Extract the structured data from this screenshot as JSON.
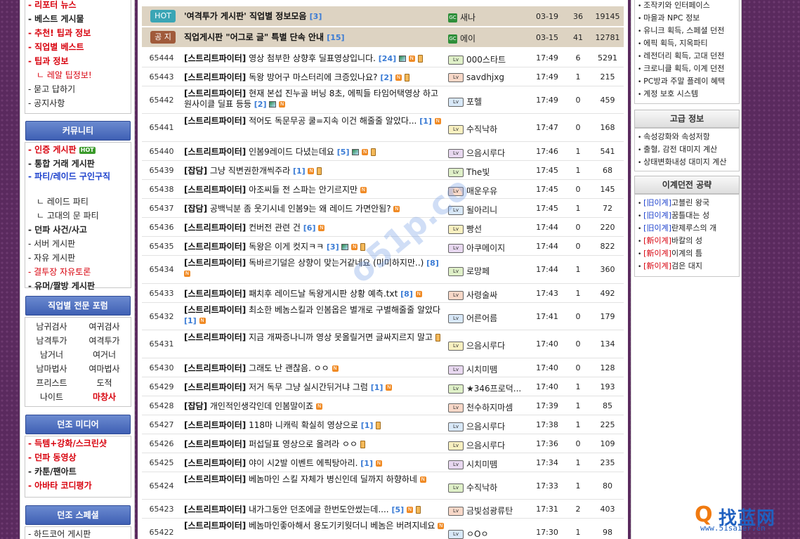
{
  "left_nav": {
    "top_items": [
      {
        "label": "리포터 뉴스",
        "style": "bold-red"
      },
      {
        "label": "베스트 게시물",
        "style": "bold"
      },
      {
        "label": "추천! 팁과 정보",
        "style": "bold-red"
      },
      {
        "label": "직업별 베스트",
        "style": "bold-red"
      },
      {
        "label": "팁과 정보",
        "style": "bold-red"
      },
      {
        "label": "ㄴ 레알 팁정보!",
        "style": "sub-red"
      },
      {
        "label": "묻고 답하기",
        "style": "normal"
      },
      {
        "label": "공지사항",
        "style": "normal"
      }
    ],
    "community_title": "커뮤니티",
    "community_items": [
      {
        "label": "인증 게시판",
        "style": "bold-red",
        "badge": "HOT"
      },
      {
        "label": "통합 거래 게시판",
        "style": "bold"
      },
      {
        "label": "파티/레이드 구인구직",
        "style": "bold-blue"
      },
      {
        "label": "ㄴ 레이드 파티",
        "style": "sub"
      },
      {
        "label": "ㄴ 고대의 문 파티",
        "style": "sub"
      },
      {
        "label": "던파 사건/사고",
        "style": "bold"
      },
      {
        "label": "서버 게시판",
        "style": "normal"
      },
      {
        "label": "자유 게시판",
        "style": "normal"
      },
      {
        "label": "결투장 자유토론",
        "style": "red"
      },
      {
        "label": "유머/짤방 게시판",
        "style": "bold"
      }
    ],
    "forum_title": "직업별 전문 포럼",
    "forum_items": [
      "남귀검사",
      "여귀검사",
      "남격투가",
      "여격투가",
      "남거너",
      "여거너",
      "남마법사",
      "여마법사",
      "프리스트",
      "도적",
      "나이트",
      "마창사"
    ],
    "media_title": "던조 미디어",
    "media_items": [
      {
        "label": "득템+강화/스크린샷",
        "style": "bold-red"
      },
      {
        "label": "던파 동영상",
        "style": "bold-red"
      },
      {
        "label": "카툰/팬아트",
        "style": "bold"
      },
      {
        "label": "아바타 코디평가",
        "style": "bold-red"
      }
    ],
    "special_title": "던조 스페셜",
    "special_items": [
      "하드코어 게시판"
    ]
  },
  "notices": [
    {
      "badge": "HOT",
      "badge_color": "#3aa5b5",
      "subject": "'여격투가 게시판' 직업별 정보모음",
      "comments": "[3]",
      "nick": "새나",
      "date": "03-19",
      "recommend": "36",
      "hits": "19145"
    },
    {
      "badge": "공 지",
      "badge_color": "#a05a3a",
      "subject": "직업게시판 \"어그로 글\" 특별 단속 안내",
      "comments": "[15]",
      "nick": "에이",
      "date": "03-15",
      "recommend": "41",
      "hits": "12781"
    }
  ],
  "posts": [
    {
      "num": "65444",
      "cat": "[스트리트파이터]",
      "subject": "영상 첨부한 상향후 딜표영상입니다.",
      "comments": "[24]",
      "icons": [
        "img",
        "new",
        "mov"
      ],
      "nick": "000스타트",
      "date": "17:49",
      "recommend": "6",
      "hits": "5291",
      "h": 27
    },
    {
      "num": "65443",
      "cat": "[스트리트파이터]",
      "subject": "독왕 방어구 마스터리에 크증있나요?",
      "comments": "[2]",
      "icons": [
        "new",
        "mov"
      ],
      "nick": "savdhjxg",
      "date": "17:49",
      "recommend": "1",
      "hits": "215",
      "h": 27
    },
    {
      "num": "65442",
      "cat": "[스트리트파이터]",
      "subject": "현재 본섭 진누골 버닝 8초, 에픽들 타임어택영상 하고 원사이클 딜표 등등",
      "comments": "[2]",
      "icons": [
        "img",
        "new"
      ],
      "nick": "포헬",
      "date": "17:49",
      "recommend": "0",
      "hits": "459",
      "h": 39
    },
    {
      "num": "65441",
      "cat": "[스트리트파이터]",
      "subject": "적어도 독문무공 쿨=지속 이건 해줄줄 알았다...",
      "comments": "[1]",
      "icons": [
        "new"
      ],
      "nick": "수직낙하",
      "date": "17:47",
      "recommend": "0",
      "hits": "168",
      "h": 40
    },
    {
      "num": "65440",
      "cat": "[스트리트파이터]",
      "subject": "인봄9레이드 다녔는데요",
      "comments": "[5]",
      "icons": [
        "img",
        "new",
        "mov"
      ],
      "nick": "으음시루다",
      "date": "17:46",
      "recommend": "1",
      "hits": "541",
      "h": 27
    },
    {
      "num": "65439",
      "cat": "[잡담]",
      "subject": "그냥 직변권한개씩주라",
      "comments": "[1]",
      "icons": [
        "new",
        "mov"
      ],
      "nick": "The빛",
      "date": "17:45",
      "recommend": "1",
      "hits": "68",
      "h": 27
    },
    {
      "num": "65438",
      "cat": "[스트리트파이터]",
      "subject": "아조씨들 전 스파는 안기르지만",
      "comments": "",
      "icons": [
        "new"
      ],
      "nick": "매운우유",
      "date": "17:45",
      "recommend": "0",
      "hits": "145",
      "h": 27
    },
    {
      "num": "65437",
      "cat": "[잡담]",
      "subject": "공백닉분 좀 웃기시네 인봄9는 왜 레이드 가면안됨?",
      "comments": "",
      "icons": [
        "new"
      ],
      "nick": "될아리니",
      "date": "17:45",
      "recommend": "1",
      "hits": "72",
      "h": 27
    },
    {
      "num": "65436",
      "cat": "[스트리트파이터]",
      "subject": "컨버전 관련 건",
      "comments": "[6]",
      "icons": [
        "new"
      ],
      "nick": "빵선",
      "date": "17:44",
      "recommend": "0",
      "hits": "220",
      "h": 27
    },
    {
      "num": "65435",
      "cat": "[스트리트파이터]",
      "subject": "독왕은 이게 컷지ㅋㅋ",
      "comments": "[3]",
      "icons": [
        "img",
        "new",
        "mov"
      ],
      "nick": "아쿠메이지",
      "date": "17:44",
      "recommend": "0",
      "hits": "822",
      "h": 27
    },
    {
      "num": "65434",
      "cat": "[스트리트파이터]",
      "subject": "독바르기덜은 상향이 맞는거같네요 (미미하지만..)",
      "comments": "[8]",
      "icons": [
        "new"
      ],
      "nick": "로망페",
      "date": "17:44",
      "recommend": "1",
      "hits": "360",
      "h": 40
    },
    {
      "num": "65433",
      "cat": "[스트리트파이터]",
      "subject": "패치후 레이드날 독왕게시판 상황 예측.txt",
      "comments": "[8]",
      "icons": [
        "new"
      ],
      "nick": "사령술싸",
      "date": "17:43",
      "recommend": "1",
      "hits": "492",
      "h": 27
    },
    {
      "num": "65432",
      "cat": "[스트리트파이터]",
      "subject": "최소한 베놈스킬과 인봄옵은 별개로 구별해줄줄 알았다",
      "comments": "[1]",
      "icons": [
        "new"
      ],
      "nick": "어른어름",
      "date": "17:41",
      "recommend": "0",
      "hits": "179",
      "h": 39
    },
    {
      "num": "65431",
      "cat": "[스트리트파이터]",
      "subject": "지금 개짜증나니까 영상 못올릴거면 글싸지르지 말고",
      "comments": "",
      "icons": [
        "mov"
      ],
      "nick": "으음시루다",
      "date": "17:40",
      "recommend": "0",
      "hits": "134",
      "h": 40
    },
    {
      "num": "65430",
      "cat": "[스트리트파이터]",
      "subject": "그래도 난 괜찮음. ㅇㅇ",
      "comments": "",
      "icons": [
        "new"
      ],
      "nick": "시치미뗌",
      "date": "17:40",
      "recommend": "0",
      "hits": "128",
      "h": 27
    },
    {
      "num": "65429",
      "cat": "[스트리트파이터]",
      "subject": "저거 독무 그냥 실시간뒤거냐 그럼",
      "comments": "[1]",
      "icons": [
        "new"
      ],
      "nick": "★346프로덕...",
      "date": "17:40",
      "recommend": "1",
      "hits": "193",
      "h": 27
    },
    {
      "num": "65428",
      "cat": "[잡담]",
      "subject": "개인적인생각인데 인봄말이죠",
      "comments": "",
      "icons": [
        "new"
      ],
      "nick": "천수하지마셈",
      "date": "17:39",
      "recommend": "1",
      "hits": "85",
      "h": 27
    },
    {
      "num": "65427",
      "cat": "[스트리트파이터]",
      "subject": "118마 니캐릭 확실히 영상으로",
      "comments": "[1]",
      "icons": [
        "mov"
      ],
      "nick": "으음시루다",
      "date": "17:38",
      "recommend": "1",
      "hits": "225",
      "h": 27
    },
    {
      "num": "65426",
      "cat": "[스트리트파이터]",
      "subject": "퍼섭딜표 영상으로 올려라 ㅇㅇ",
      "comments": "",
      "icons": [
        "mov"
      ],
      "nick": "으음시루다",
      "date": "17:36",
      "recommend": "0",
      "hits": "109",
      "h": 27
    },
    {
      "num": "65425",
      "cat": "[스트리트파이터]",
      "subject": "야이 시2발 이벤트 에픽탕아리.",
      "comments": "[1]",
      "icons": [
        "new"
      ],
      "nick": "시치미뗌",
      "date": "17:34",
      "recommend": "1",
      "hits": "235",
      "h": 27
    },
    {
      "num": "65424",
      "cat": "[스트리트파이터]",
      "subject": "베놈마인 스킬 자체가 병신인데 딜까지 하향하네",
      "comments": "",
      "icons": [
        "new"
      ],
      "nick": "수직낙하",
      "date": "17:33",
      "recommend": "1",
      "hits": "80",
      "h": 39
    },
    {
      "num": "65423",
      "cat": "[스트리트파이터]",
      "subject": "내가그동안 던조에글 한번도안썼는데....",
      "comments": "[5]",
      "icons": [
        "new",
        "mov"
      ],
      "nick": "금빛섬광류탄",
      "date": "17:31",
      "recommend": "2",
      "hits": "403",
      "h": 27
    },
    {
      "num": "65422",
      "cat": "[스트리트파이터]",
      "subject": "베놈마인좋아해서 용도기키웟더니 베놈은 버려지네요",
      "comments": "",
      "icons": [
        "new"
      ],
      "nick": "ㅇOㅇ",
      "date": "17:30",
      "recommend": "1",
      "hits": "98",
      "h": 40
    }
  ],
  "right_nav": {
    "top_items": [
      "조작키와 인터페이스",
      "마을과 NPC 정보",
      "유니크 획득, 스페셜 던전",
      "에픽 획득, 지옥파티",
      "레전더리 획득, 고대 던전",
      "크로니클 획득, 이계 던전",
      "PC방과 주말 플레이 혜택",
      "계정 보호 시스템"
    ],
    "advanced_title": "고급 정보",
    "advanced_items": [
      "속성강화와 속성저항",
      "출혈, 감전 대미지 계산",
      "상태변화내성 대미지 계산"
    ],
    "otherworld_title": "이계던전 공략",
    "otherworld_items": [
      {
        "tag": "[旧이계]",
        "tag_style": "blue",
        "label": "고블린 왕국"
      },
      {
        "tag": "[旧이계]",
        "tag_style": "blue",
        "label": "꿈틀대는 성"
      },
      {
        "tag": "[旧이계]",
        "tag_style": "blue",
        "label": "란제루스의 개"
      },
      {
        "tag": "[新이계]",
        "tag_style": "red",
        "label": "바칼의 성"
      },
      {
        "tag": "[新이계]",
        "tag_style": "red",
        "label": "이계의 틈"
      },
      {
        "tag": "[新이계]",
        "tag_style": "red",
        "label": "검은 대지"
      }
    ]
  },
  "watermark": {
    "center_text": "o51p.co",
    "logo_main": "找蓝网",
    "logo_url": "www.51saier.cn"
  }
}
